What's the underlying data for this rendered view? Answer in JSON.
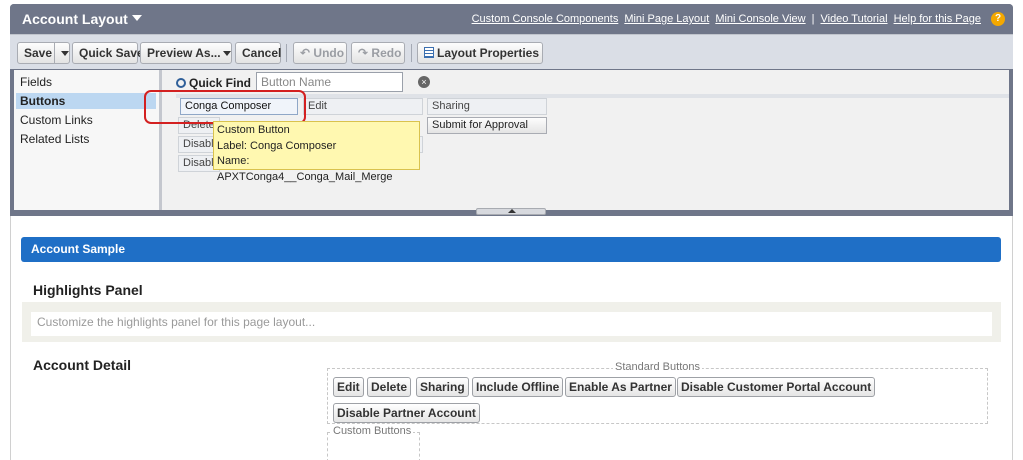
{
  "header": {
    "title": "Account Layout",
    "links": [
      "Custom Console Components",
      "Mini Page Layout",
      "Mini Console View"
    ],
    "link_separator": "|",
    "right_links": [
      "Video Tutorial",
      "Help for this Page"
    ],
    "help_icon": "?"
  },
  "toolbar": {
    "save": "Save",
    "quick_save": "Quick Save",
    "preview_as": "Preview As...",
    "cancel": "Cancel",
    "undo": "Undo",
    "redo": "Redo",
    "layout_properties": "Layout Properties"
  },
  "palette": {
    "categories": [
      "Fields",
      "Buttons",
      "Custom Links",
      "Related Lists"
    ],
    "active_category": "Buttons",
    "quick_find_label": "Quick Find",
    "quick_find_placeholder": "Button Name",
    "buttons": {
      "conga_composer": "Conga Composer",
      "edit": "Edit",
      "sharing": "Sharing",
      "delete_partial": "Delete",
      "submit_for_approval": "Submit for Approval",
      "disable_1_partial": "Disabl",
      "disable_2_partial": "Disabl"
    },
    "tooltip": {
      "line1": "Custom Button",
      "line2": "Label: Conga Composer",
      "line3": "Name: APXTConga4__Conga_Mail_Merge"
    }
  },
  "canvas": {
    "section_title": "Account Sample",
    "highlights_heading": "Highlights Panel",
    "highlights_placeholder": "Customize the highlights panel for this page layout...",
    "detail_heading": "Account Detail",
    "standard_buttons_legend": "Standard Buttons",
    "standard_buttons": [
      "Edit",
      "Delete",
      "Sharing",
      "Include Offline",
      "Enable As Partner",
      "Disable Customer Portal Account",
      "Disable Partner Account"
    ],
    "custom_buttons_legend": "Custom Buttons"
  },
  "colors": {
    "palette_header": "#6f7689",
    "section_bar": "#1f6fc6",
    "tooltip_bg": "#fff8b0",
    "highlight_ring": "#d32020",
    "help_icon": "#f4a800"
  }
}
